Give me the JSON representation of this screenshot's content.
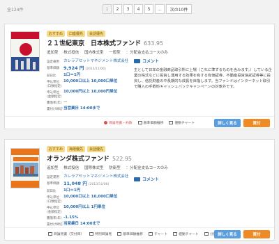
{
  "header": {
    "count": "全124件",
    "pages": [
      "1",
      "2",
      "3",
      "4",
      "5",
      "..."
    ],
    "next_label": "次の10件"
  },
  "cards": [
    {
      "tags": [
        "おすすめ",
        "口座優先",
        "会話優先"
      ],
      "name": "２１世紀東京　日本株式ファンド",
      "code": "633.95",
      "cats": [
        "追加型",
        "株式投信",
        "国内株式型",
        "一般型",
        "：分配金支払コースのみ"
      ],
      "rows": [
        {
          "label": "設定運用",
          "value": "カレラアセットマネジメント株式会社"
        },
        {
          "label": "基準価額",
          "value": "9,924 円",
          "sub": "(2013/11/06)"
        },
        {
          "label": "前日比",
          "value": "1口＝1円"
        },
        {
          "label": "申込単位(口数指定)",
          "value": "10,000口以上 10,000口単位"
        },
        {
          "label": "申込単位(金額指定)",
          "value": "10,000円以上 10,000円単位"
        },
        {
          "label": "騰落率(年)",
          "value": "—"
        },
        {
          "label": "置付け締切",
          "value": "当営業日 14:00まで"
        }
      ],
      "comment_title": "コメント",
      "comment": "主として日本の金融商品取引所に上場（これに準ずるものを含みます。）している企業の株式などに投資し運用する効果を有する有価証券、不動産投資信託証券等に投資し、信託財産の中長期的な成長を目指します。当ファンドはインターネット取引で購入の手数料キャッシュバックキャンペーンの対象外です。",
      "actions": [
        "目論見書・約款",
        "基準価額推移",
        "値動チャート"
      ],
      "detail_label": "詳しく見る",
      "buy_label": "買付"
    },
    {
      "tags": [
        "おすすめ",
        "海運優先",
        "会話優先"
      ],
      "name": "オランダ株式ファンド",
      "code": "522.95",
      "cats": [
        "追加型",
        "株式投信",
        "国際株式型",
        "防衛型",
        "：分配金支払コースのみ"
      ],
      "rows": [
        {
          "label": "設定運用",
          "value": "カレラアセットマネジメント株式会社"
        },
        {
          "label": "基準価額",
          "value": "11,048 円",
          "sub": "(2013/11/06)"
        },
        {
          "label": "前日比",
          "value": "1口＝1円"
        },
        {
          "label": "申込単位(口数指定)",
          "value": "10,000口以上 10,000口単位"
        },
        {
          "label": "申込単位(金額指定)",
          "value": "10,000円以上 1円単位"
        },
        {
          "label": "騰落率(年)",
          "value": "-1.15%"
        },
        {
          "label": "置付け締切",
          "value": "当営業日 14:00まで"
        }
      ],
      "comment_title": "コメント",
      "comment": "",
      "actions": [
        "目論見書（交付目）",
        "特別目論見",
        "基準価額推移",
        "チャート",
        "値動チャート",
        "分配金実績"
      ],
      "detail_label": "詳しく見る",
      "buy_label": "買付"
    }
  ]
}
